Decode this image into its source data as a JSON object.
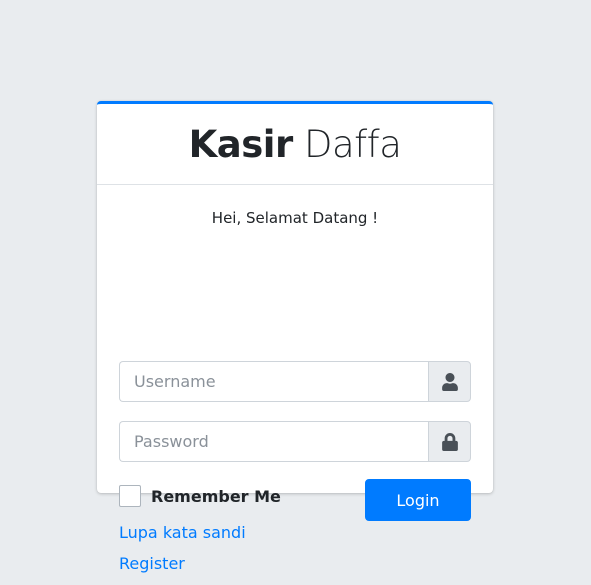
{
  "brand": {
    "bold": "Kasir",
    "light": "Daffa"
  },
  "login_message": "Hei, Selamat Datang !",
  "username": {
    "placeholder": "Username",
    "value": "",
    "icon": "user-icon"
  },
  "password": {
    "placeholder": "Password",
    "value": "",
    "icon": "lock-icon"
  },
  "remember": {
    "label": "Remember Me",
    "checked": false
  },
  "login_button": "Login",
  "links": {
    "forgot": "Lupa kata sandi",
    "register": "Register"
  },
  "colors": {
    "primary": "#007bff",
    "background": "#e9ecef",
    "card": "#ffffff"
  }
}
